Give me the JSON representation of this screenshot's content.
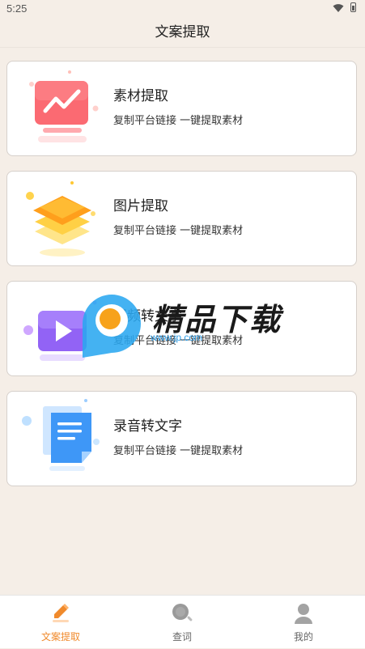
{
  "status_bar": {
    "time": "5:25",
    "icons": [
      "wifi-icon",
      "battery-icon"
    ]
  },
  "nav": {
    "title": "文案提取"
  },
  "cards": [
    {
      "title": "素材提取",
      "subtitle": "复制平台链接 一键提取素材",
      "icon": "chart-monitor-icon"
    },
    {
      "title": "图片提取",
      "subtitle": "复制平台链接 一键提取素材",
      "icon": "layers-icon"
    },
    {
      "title": "视频转文字",
      "subtitle": "复制平台链接 一键提取素材",
      "icon": "video-play-icon"
    },
    {
      "title": "录音转文字",
      "subtitle": "复制平台链接 一键提取素材",
      "icon": "document-icon"
    }
  ],
  "watermark": {
    "text": "精品下载",
    "url": "www.jp.com"
  },
  "tabs": [
    {
      "label": "文案提取",
      "icon": "pencil-icon",
      "active": true
    },
    {
      "label": "查词",
      "icon": "search-icon",
      "active": false
    },
    {
      "label": "我的",
      "icon": "user-icon",
      "active": false
    }
  ],
  "colors": {
    "background": "#f5eee7",
    "accent": "#f08a2c",
    "card_border": "#d6d0cb"
  }
}
